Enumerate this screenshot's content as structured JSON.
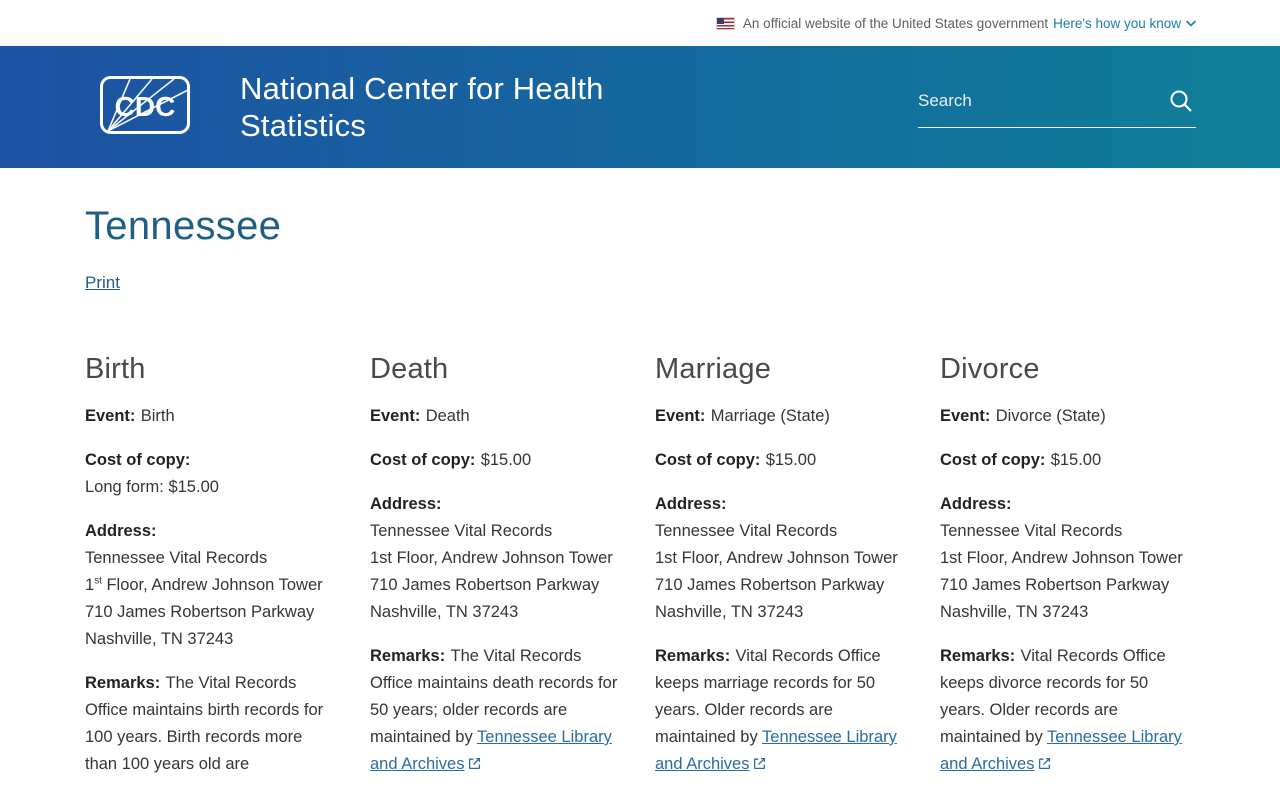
{
  "banner": {
    "text": "An official website of the United States government",
    "link_label": "Here's how you know"
  },
  "header": {
    "logo_label": "CDC",
    "title": "National Center for Health Statistics",
    "search_placeholder": "Search"
  },
  "main": {
    "page_title": "Tennessee",
    "print_link": "Print"
  },
  "colors": {
    "header_gradient_start": "#1e52a3",
    "header_gradient_end": "#0f8098",
    "page_title_blue": "#205e83",
    "body_link_blue": "#2b6d9f",
    "banner_link_blue": "#1b7fa8",
    "section_heading_gray": "#47494d"
  },
  "sections": [
    {
      "heading": "Birth",
      "event_label": "Event:",
      "event_value": "Birth",
      "cost_label": "Cost of copy:",
      "cost_value": "Long form: $15.00",
      "address_label": "Address:",
      "address_line1": "Tennessee Vital Records",
      "floor_line": {
        "pre": "1",
        "sup": "st",
        "rest": " Floor, Andrew Johnson Tower"
      },
      "address_line3": "710 James Robertson Parkway",
      "address_line4": "Nashville, TN 37243",
      "remarks_label": "Remarks:",
      "remarks_text": "The Vital Records Office maintains birth records for 100 years. Birth records more than 100 years old are",
      "remarks_link": ""
    },
    {
      "heading": "Death",
      "event_label": "Event:",
      "event_value": "Death",
      "cost_label": "Cost of copy:",
      "cost_value": "$15.00",
      "address_label": "Address:",
      "address_line1": "Tennessee Vital Records",
      "floor_line": {
        "pre": "1st",
        "sup": "",
        "rest": " Floor, Andrew Johnson Tower"
      },
      "address_line3": "710 James Robertson Parkway",
      "address_line4": "Nashville, TN 37243",
      "remarks_label": "Remarks:",
      "remarks_text": "The Vital Records Office maintains death records for 50 years; older records are maintained by ",
      "remarks_link": "Tennessee Library and Archives"
    },
    {
      "heading": "Marriage",
      "event_label": "Event:",
      "event_value": "Marriage (State)",
      "cost_label": "Cost of copy:",
      "cost_value": "$15.00",
      "address_label": "Address:",
      "address_line1": "Tennessee Vital Records",
      "floor_line": {
        "pre": "1st",
        "sup": "",
        "rest": " Floor, Andrew Johnson Tower"
      },
      "address_line3": "710 James Robertson Parkway",
      "address_line4": "Nashville, TN 37243",
      "remarks_label": "Remarks:",
      "remarks_text": "Vital Records Office keeps marriage records for 50 years. Older records are maintained by ",
      "remarks_link": "Tennessee Library and Archives"
    },
    {
      "heading": "Divorce",
      "event_label": "Event:",
      "event_value": "Divorce (State)",
      "cost_label": "Cost of copy:",
      "cost_value": "$15.00",
      "address_label": "Address:",
      "address_line1": "Tennessee Vital Records",
      "floor_line": {
        "pre": "1st",
        "sup": "",
        "rest": " Floor, Andrew Johnson Tower"
      },
      "address_line3": "710 James Robertson Parkway",
      "address_line4": "Nashville, TN 37243",
      "remarks_label": "Remarks:",
      "remarks_text": "Vital Records Office keeps divorce records for 50 years. Older records are maintained by ",
      "remarks_link": "Tennessee Library and Archives"
    }
  ]
}
